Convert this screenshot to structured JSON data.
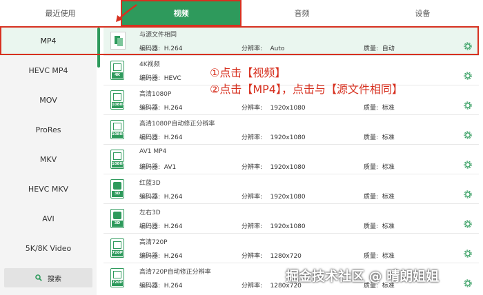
{
  "tabs": [
    {
      "label": "最近使用"
    },
    {
      "label": "视频"
    },
    {
      "label": "音频"
    },
    {
      "label": "设备"
    }
  ],
  "sidebar": {
    "items": [
      "MP4",
      "HEVC MP4",
      "MOV",
      "ProRes",
      "MKV",
      "HEVC MKV",
      "AVI",
      "5K/8K Video"
    ],
    "search_label": "搜索"
  },
  "labels": {
    "encoder": "编码器:",
    "resolution": "分辨率:",
    "quality": "质量:"
  },
  "presets": [
    {
      "name": "与源文件相同",
      "encoder": "H.264",
      "resolution": "Auto",
      "quality": "自动",
      "icon_tag": ""
    },
    {
      "name": "4K视频",
      "encoder": "HEVC",
      "resolution": "",
      "quality": "",
      "icon_tag": "4K"
    },
    {
      "name": "高清1080P",
      "encoder": "H.264",
      "resolution": "1920x1080",
      "quality": "标准",
      "icon_tag": "1080P"
    },
    {
      "name": "高清1080P自动修正分辨率",
      "encoder": "H.264",
      "resolution": "1920x1080",
      "quality": "标准",
      "icon_tag": "1080P"
    },
    {
      "name": "AV1 MP4",
      "encoder": "AV1",
      "resolution": "1920x1080",
      "quality": "标准",
      "icon_tag": "1080P"
    },
    {
      "name": "红蓝3D",
      "encoder": "H.264",
      "resolution": "1920x1080",
      "quality": "标准",
      "icon_tag": "3D"
    },
    {
      "name": "左右3D",
      "encoder": "H.264",
      "resolution": "1920x1080",
      "quality": "标准",
      "icon_tag": "3D"
    },
    {
      "name": "高清720P",
      "encoder": "H.264",
      "resolution": "1280x720",
      "quality": "标准",
      "icon_tag": "720P"
    },
    {
      "name": "高清720P自动修正分辨率",
      "encoder": "H.264",
      "resolution": "1280x720",
      "quality": "标准",
      "icon_tag": "720P"
    }
  ],
  "annotations": {
    "step1": "①点击【视频】",
    "step2": "②点击【MP4】，点击与【源文件相同】"
  },
  "watermark": "掘金技术社区 @ 晴朗姐姐",
  "colors": {
    "accent": "#2e9a5c",
    "highlight": "#d7301f"
  },
  "icons": [
    "search-icon",
    "gear-icon",
    "video-preset-icon",
    "arrow-icon"
  ]
}
